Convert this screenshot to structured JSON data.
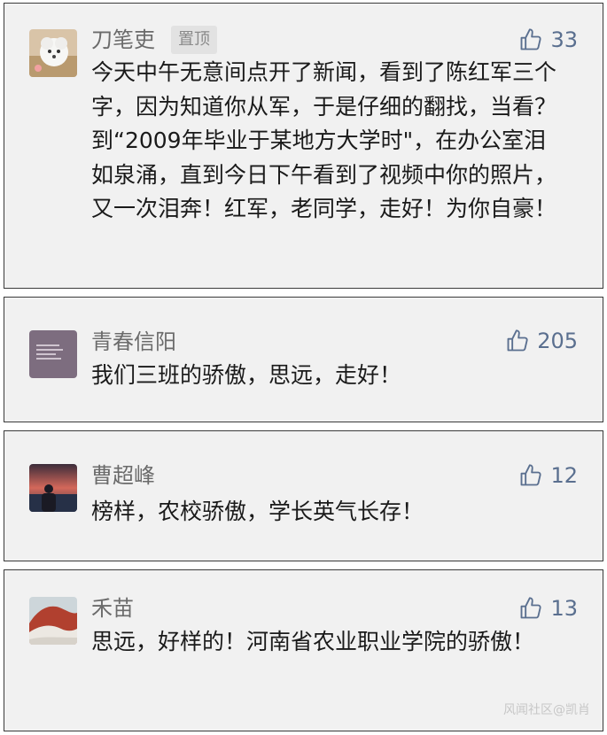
{
  "comments": [
    {
      "author": "刀笔吏",
      "badge": "置顶",
      "likes": "33",
      "text": "今天中午无意间点开了新闻，看到了陈红军三个字，因为知道你从军，于是仔细的翻找，当看？到“2009年毕业于某地方大学时\"，在办公室泪如泉涌，直到今日下午看到了视频中你的照片，又一次泪奔！红军，老同学，走好！为你自豪！",
      "avatar": "white-puppy-avatar"
    },
    {
      "author": "青春信阳",
      "likes": "205",
      "text": "我们三班的骄傲，思远，走好！",
      "avatar": "purple-text-avatar"
    },
    {
      "author": "曹超峰",
      "likes": "12",
      "text": "榜样，农校骄傲，学长英气长存！",
      "avatar": "sunset-person-avatar"
    },
    {
      "author": "禾苗",
      "likes": "13",
      "text": "思远，好样的！河南省农业职业学院的骄傲！",
      "avatar": "red-landscape-avatar"
    }
  ],
  "watermark": "风闻社区@凯肖",
  "colors": {
    "card_bg": "#f1f1f1",
    "like_blue": "#5a6f8f",
    "name_gray": "#6b6b6b"
  }
}
